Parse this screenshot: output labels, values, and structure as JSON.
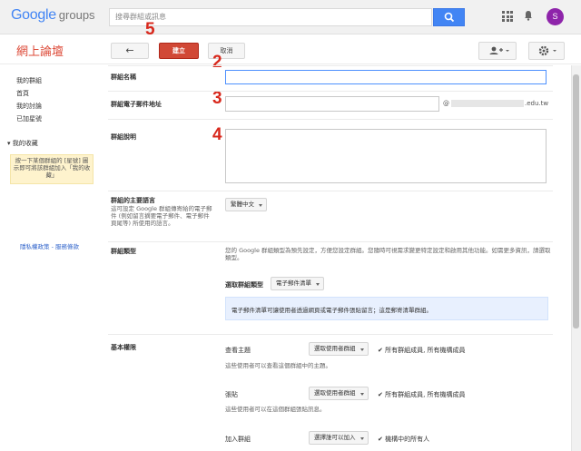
{
  "header": {
    "logo_google": "Google",
    "logo_groups": "groups",
    "search_placeholder": "搜尋群組或訊息",
    "avatar_letter": "S"
  },
  "toolbar": {
    "group_title": "網上論壇",
    "back_label": "←",
    "create_label": "建立",
    "cancel_label": "取消"
  },
  "annotations": [
    "5",
    "2",
    "3",
    "4"
  ],
  "sidebar": {
    "items": [
      {
        "label": "我的群組"
      },
      {
        "label": "首頁"
      },
      {
        "label": "我的討論"
      },
      {
        "label": "已加星號"
      }
    ],
    "favorites_label": "▾ 我的收藏",
    "favorites_note": "按一下某個群組的 [星號] 圖示即可將該群組加入「我的收藏」",
    "footer": "隱私權政策 - 服務條款"
  },
  "form": {
    "name_label": "群組名稱",
    "email_label": "群組電子郵件地址",
    "email_at": "@",
    "email_domain": ".edu.tw",
    "desc_label": "群組說明",
    "language_label": "群組的主要語言",
    "language_help": "這可設定 Google 群組傳寄給的電子郵件 (例如留言摘要電子郵件、電子郵件頁尾等) 所使用的語言。",
    "language_value": "繁體中文",
    "type_label": "群組類型",
    "type_help": "您的 Google 群組類型為預先設定，方便您設定群組。您隨時可視需求變更特定設定和啟用其他功能。如需更多資訊，請選取類型。",
    "type_select_label": "選取群組類型",
    "type_value": "電子郵件清單",
    "type_info": "電子郵件清單可讓使用者透過網頁或電子郵件張貼留言；這是郵寄清單群組。",
    "perms_label": "基本權限",
    "perms": [
      {
        "label": "查看主題",
        "value": "選取使用者群組",
        "checked": "所有群組成員, 所有機構成員",
        "help": "這些使用者可以查看這個群組中的主題。"
      },
      {
        "label": "張貼",
        "value": "選取使用者群組",
        "checked": "所有群組成員, 所有機構成員",
        "help": "這些使用者可以在這個群組張貼訊息。"
      },
      {
        "label": "加入群組",
        "value": "選擇誰可以加入",
        "checked": "機構中的所有人",
        "help": ""
      }
    ]
  }
}
